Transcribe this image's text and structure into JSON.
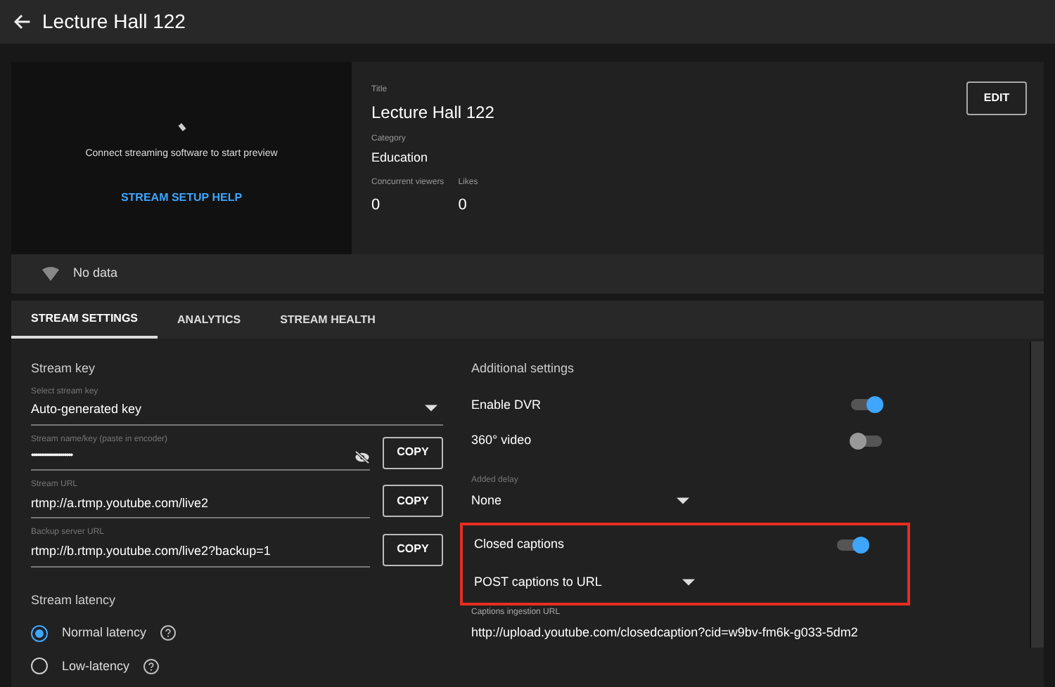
{
  "header": {
    "title": "Lecture Hall 122"
  },
  "preview": {
    "message": "Connect streaming software to start preview",
    "help_link": "STREAM SETUP HELP"
  },
  "details": {
    "edit_button": "EDIT",
    "fields": [
      {
        "label": "Title",
        "value": "Lecture Hall 122",
        "kind": "large"
      },
      {
        "label": "Category",
        "value": "Education",
        "kind": "normal"
      }
    ],
    "stats": [
      {
        "label": "Concurrent viewers",
        "value": "0"
      },
      {
        "label": "Likes",
        "value": "0"
      }
    ]
  },
  "health_bar": {
    "status": "No data"
  },
  "tabs": [
    {
      "label": "STREAM SETTINGS",
      "selected": true
    },
    {
      "label": "ANALYTICS",
      "selected": false
    },
    {
      "label": "STREAM HEALTH",
      "selected": false
    }
  ],
  "stream_key": {
    "heading": "Stream key",
    "select": {
      "label": "Select stream key",
      "value": "Auto-generated key"
    },
    "fields": [
      {
        "label": "Stream name/key (paste in encoder)",
        "value": "••••••••••••••••••••",
        "kind": "secret",
        "button": "COPY"
      },
      {
        "label": "Stream URL",
        "value": "rtmp://a.rtmp.youtube.com/live2",
        "kind": "text",
        "button": "COPY"
      },
      {
        "label": "Backup server URL",
        "value": "rtmp://b.rtmp.youtube.com/live2?backup=1",
        "kind": "text",
        "button": "COPY"
      }
    ]
  },
  "latency": {
    "heading": "Stream latency",
    "options": [
      {
        "label": "Normal latency",
        "selected": true
      },
      {
        "label": "Low-latency",
        "selected": false
      }
    ]
  },
  "additional": {
    "heading": "Additional settings",
    "toggles": [
      {
        "label": "Enable DVR",
        "on": true
      },
      {
        "label": "360° video",
        "on": false
      }
    ],
    "delay": {
      "label": "Added delay",
      "value": "None"
    },
    "captions": {
      "highlighted": true,
      "label": "Closed captions",
      "on": true,
      "method": "POST captions to URL"
    },
    "ingestion": {
      "label": "Captions ingestion URL",
      "value": "http://upload.youtube.com/closedcaption?cid=w9bv-fm6k-g033-5dm2"
    }
  }
}
